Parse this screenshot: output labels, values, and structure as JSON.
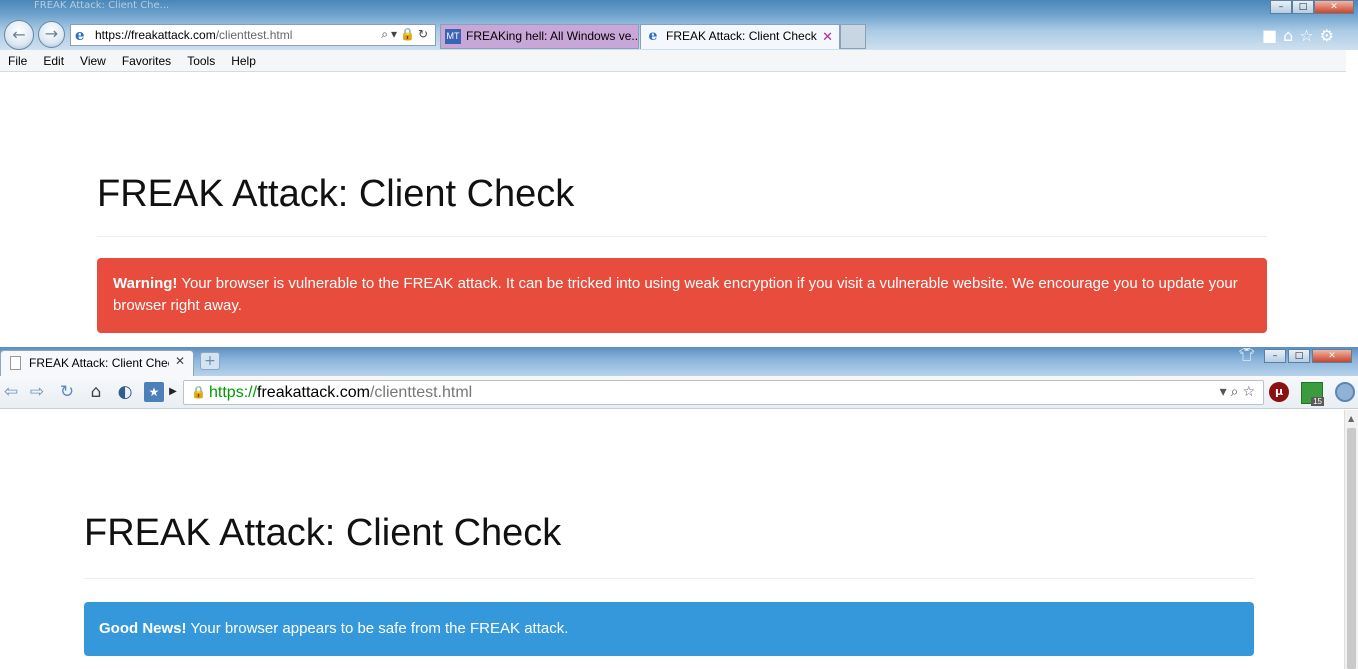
{
  "ie": {
    "ghost_title": "FREAK Attack: Client Che...",
    "url": {
      "host": "https://freakattack.com",
      "path": "/clienttest.html"
    },
    "tabs": [
      {
        "label": "FREAKing hell: All Windows ve...",
        "favicon": "MT"
      },
      {
        "label": "FREAK Attack: Client Check",
        "favicon": "e"
      }
    ],
    "menu": [
      "File",
      "Edit",
      "View",
      "Favorites",
      "Tools",
      "Help"
    ],
    "page": {
      "heading": "FREAK Attack: Client Check",
      "alert_strong": "Warning!",
      "alert_text": " Your browser is vulnerable to the FREAK attack. It can be tricked into using weak encryption if you visit a vulnerable website. We encourage you to update your browser right away.",
      "alert_color": "#e74c3c"
    }
  },
  "chrome": {
    "tab_label": "FREAK Attack: Client Check",
    "url": {
      "scheme": "https://",
      "host": "freakattack.com",
      "path": "/clienttest.html"
    },
    "extension_count": "15",
    "page": {
      "heading": "FREAK Attack: Client Check",
      "alert_strong": "Good News!",
      "alert_text": " Your browser appears to be safe from the FREAK attack.",
      "alert_color": "#3498db"
    }
  }
}
